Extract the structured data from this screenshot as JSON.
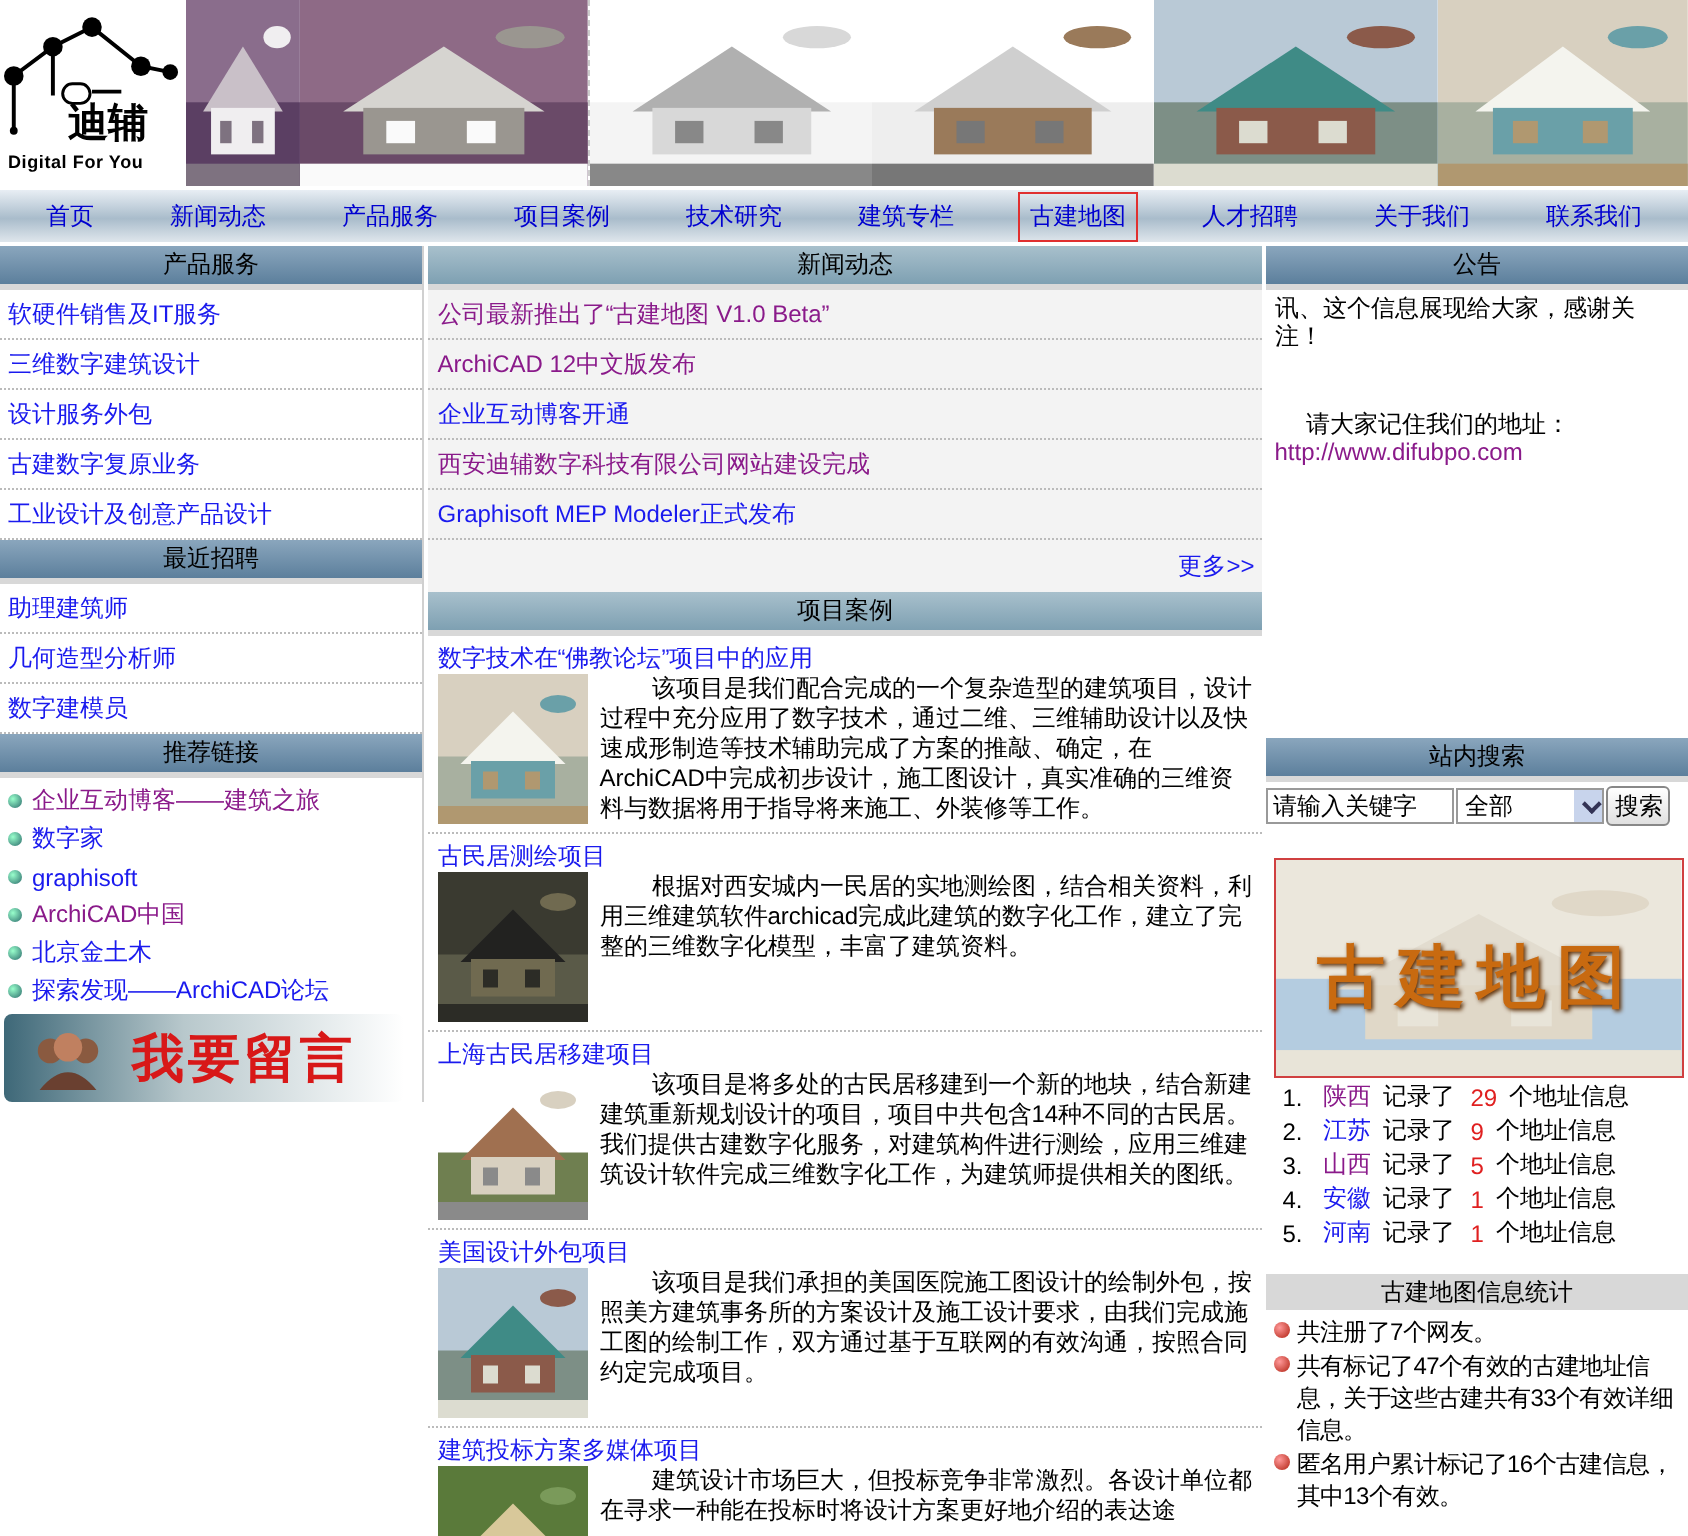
{
  "logo": {
    "name": "迪辅",
    "tagline": "Digital For You"
  },
  "nav": [
    {
      "label": "首页",
      "selected": false
    },
    {
      "label": "新闻动态",
      "selected": false
    },
    {
      "label": "产品服务",
      "selected": false
    },
    {
      "label": "项目案例",
      "selected": false
    },
    {
      "label": "技术研究",
      "selected": false
    },
    {
      "label": "建筑专栏",
      "selected": false
    },
    {
      "label": "古建地图",
      "selected": true
    },
    {
      "label": "人才招聘",
      "selected": false
    },
    {
      "label": "关于我们",
      "selected": false
    },
    {
      "label": "联系我们",
      "selected": false
    }
  ],
  "left": {
    "products": {
      "title": "产品服务",
      "items": [
        {
          "label": "软硬件销售及IT服务",
          "visited": false
        },
        {
          "label": "三维数字建筑设计",
          "visited": false
        },
        {
          "label": "设计服务外包",
          "visited": false
        },
        {
          "label": "古建数字复原业务",
          "visited": false
        },
        {
          "label": "工业设计及创意产品设计",
          "visited": false
        }
      ]
    },
    "jobs": {
      "title": "最近招聘",
      "items": [
        {
          "label": "助理建筑师",
          "visited": false
        },
        {
          "label": "几何造型分析师",
          "visited": false
        },
        {
          "label": "数字建模员",
          "visited": false
        }
      ]
    },
    "links": {
      "title": "推荐链接",
      "items": [
        {
          "label": "企业互动博客——建筑之旅",
          "visited": true
        },
        {
          "label": "数字家",
          "visited": false
        },
        {
          "label": "graphisoft",
          "visited": false
        },
        {
          "label": "ArchiCAD中国",
          "visited": true
        },
        {
          "label": "北京金土木",
          "visited": false
        },
        {
          "label": "探索发现——ArchiCAD论坛",
          "visited": false
        }
      ]
    },
    "message_button": "我要留言"
  },
  "news": {
    "title": "新闻动态",
    "items": [
      {
        "label": "公司最新推出了“古建地图  V1.0 Beta”",
        "visited": true
      },
      {
        "label": "ArchiCAD 12中文版发布",
        "visited": true
      },
      {
        "label": "企业互动博客开通",
        "visited": false
      },
      {
        "label": "西安迪辅数字科技有限公司网站建设完成",
        "visited": true
      },
      {
        "label": "Graphisoft MEP Modeler正式发布",
        "visited": false
      }
    ],
    "more": "更多>>"
  },
  "projects": {
    "title": "项目案例",
    "items": [
      {
        "title": "数字技术在“佛教论坛”项目中的应用",
        "text": "该项目是我们配合完成的一个复杂造型的建筑项目，设计过程中充分应用了数字技术，通过二维、三维辅助设计以及快速成形制造等技术辅助完成了方案的推敲、确定，在ArchiCAD中完成初步设计，施工图设计，真实准确的三维资料与数据将用于指导将来施工、外装修等工作。"
      },
      {
        "title": "古民居测绘项目",
        "text": "根据对西安城内一民居的实地测绘图，结合相关资料，利用三维建筑软件archicad完成此建筑的数字化工作，建立了完整的三维数字化模型，丰富了建筑资料。"
      },
      {
        "title": "上海古民居移建项目",
        "text": "该项目是将多处的古民居移建到一个新的地块，结合新建建筑重新规划设计的项目，项目中共包含14种不同的古民居。我们提供古建数字化服务，对建筑构件进行测绘，应用三维建筑设计软件完成三维数字化工作，为建筑师提供相关的图纸。"
      },
      {
        "title": "美国设计外包项目",
        "text": "该项目是我们承担的美国医院施工图设计的绘制外包，按照美方建筑事务所的方案设计及施工设计要求，由我们完成施工图的绘制工作，双方通过基于互联网的有效沟通，按照合同约定完成项目。"
      },
      {
        "title": "建筑投标方案多媒体项目",
        "text": "建筑设计市场巨大，但投标竞争非常激烈。各设计单位都在寻求一种能在投标时将设计方案更好地介绍的表达途"
      }
    ]
  },
  "notice": {
    "title": "公告",
    "lines": [
      "讯、这个信息展现给大家，感谢关注！",
      "请大家记住我们的地址："
    ],
    "url": "http://www.difubpo.com"
  },
  "search": {
    "title": "站内搜索",
    "placeholder": "请输入关键字",
    "scope": "全部",
    "button": "搜索"
  },
  "map_banner": {
    "title": "古建地图"
  },
  "ranking": [
    {
      "num": "1.",
      "province": "陕西",
      "visited": true,
      "verb": "记录了",
      "count": "29",
      "unit": "个地址信息"
    },
    {
      "num": "2.",
      "province": "江苏",
      "visited": false,
      "verb": "记录了",
      "count": "9",
      "unit": "个地址信息"
    },
    {
      "num": "3.",
      "province": "山西",
      "visited": true,
      "verb": "记录了",
      "count": "5",
      "unit": "个地址信息"
    },
    {
      "num": "4.",
      "province": "安徽",
      "visited": false,
      "verb": "记录了",
      "count": "1",
      "unit": "个地址信息"
    },
    {
      "num": "5.",
      "province": "河南",
      "visited": false,
      "verb": "记录了",
      "count": "1",
      "unit": "个地址信息"
    }
  ],
  "stats": {
    "title": "古建地图信息统计",
    "items": [
      "共注册了7个网友。",
      "共有标记了47个有效的古建地址信息，关于这些古建共有33个有效详细信息。",
      "匿名用户累计标记了16个古建信息，其中13个有效。"
    ]
  }
}
